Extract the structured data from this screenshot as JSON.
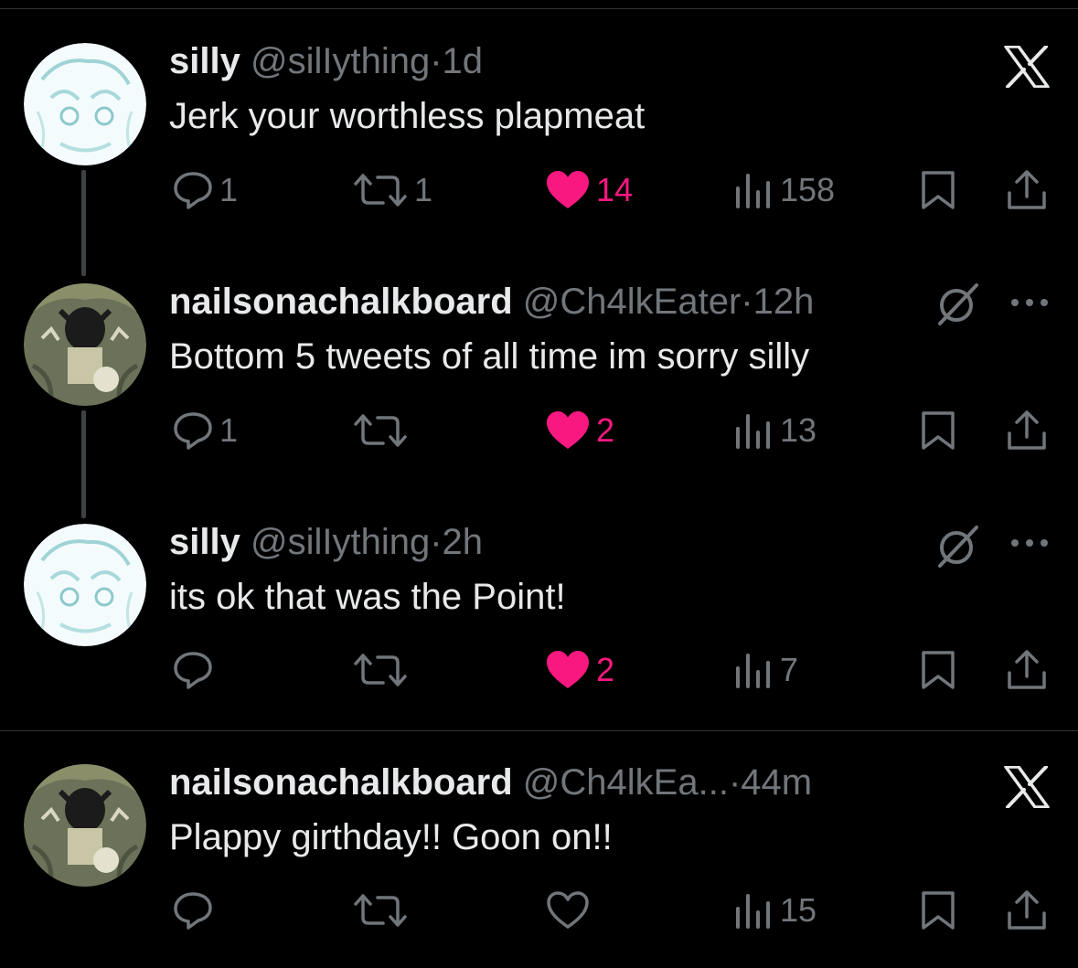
{
  "tweets": [
    {
      "name": "silly",
      "handle": "@silIything",
      "separator": "·",
      "time": "1d",
      "text": "Jerk your worthless plapmeat",
      "replies": "1",
      "reposts": "1",
      "likes": "14",
      "liked": true,
      "views": "158",
      "top_right": "x-logo"
    },
    {
      "name": "nailsonachalkboard",
      "handle": "@Ch4lkEater",
      "separator": "·",
      "time": "12h",
      "text": "Bottom 5 tweets of all time im sorry silly",
      "replies": "1",
      "reposts": "",
      "likes": "2",
      "liked": true,
      "views": "13",
      "top_right": "grok-icon"
    },
    {
      "name": "silly",
      "handle": "@silIything",
      "separator": "·",
      "time": "2h",
      "text": "its ok that was the Point!",
      "replies": "",
      "reposts": "",
      "likes": "2",
      "liked": true,
      "views": "7",
      "top_right": "grok-icon"
    },
    {
      "name": "nailsonachalkboard",
      "handle": "@Ch4lkEa...",
      "separator": "·",
      "time": "44m",
      "text": "Plappy girthday!! Goon on!!",
      "replies": "",
      "reposts": "",
      "likes": "",
      "liked": false,
      "views": "15",
      "top_right": "x-logo"
    }
  ],
  "colors": {
    "background": "#000000",
    "text": "#e7e9ea",
    "muted": "#71767b",
    "like": "#f91880",
    "divider": "#2f3336"
  }
}
